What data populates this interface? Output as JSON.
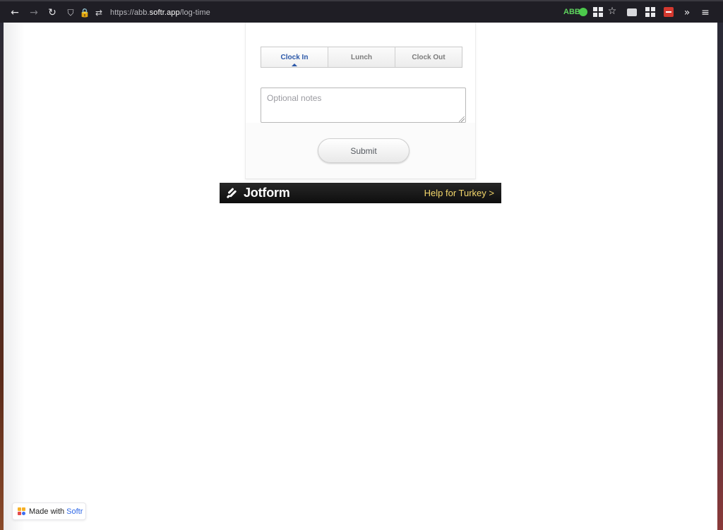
{
  "browser": {
    "url_prefix": "https://abb.",
    "url_domain": "softr.app",
    "url_path": "/log-time",
    "extension_badge": "ABB"
  },
  "form": {
    "tabs": [
      {
        "label": "Clock In",
        "active": true
      },
      {
        "label": "Lunch",
        "active": false
      },
      {
        "label": "Clock Out",
        "active": false
      }
    ],
    "notes_placeholder": "Optional notes",
    "submit_label": "Submit"
  },
  "jotform_banner": {
    "brand": "Jotform",
    "link_text": "Help for Turkey >"
  },
  "softr_badge": {
    "made_with": "Made with",
    "brand": "Softr"
  },
  "colors": {
    "active_tab": "#2a57a8",
    "banner_link": "#f3d66a",
    "softr_brand": "#2e67e6"
  }
}
